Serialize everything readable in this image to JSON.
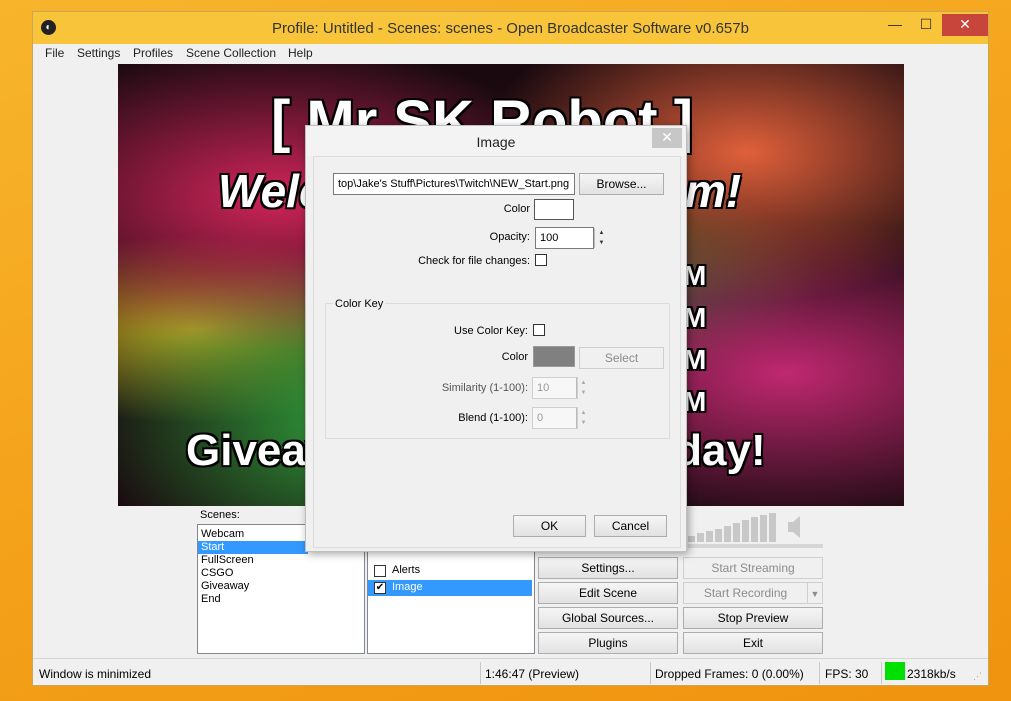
{
  "window": {
    "title": "Profile: Untitled - Scenes: scenes - Open Broadcaster Software v0.657b",
    "minimize": "—",
    "maximize": "☐",
    "close": "✕"
  },
  "menu": [
    "File",
    "Settings",
    "Profiles",
    "Scene Collection",
    "Help"
  ],
  "preview": {
    "line1": "[ Mr SK Robot ]",
    "line2": "Welcome to the Stream!",
    "line3": "Giveaways every Thursday!",
    "m_letters": [
      "M",
      "M",
      "M",
      "M"
    ]
  },
  "scenes": {
    "label": "Scenes:",
    "items": [
      "Webcam",
      "Start",
      "FullScreen",
      "CSGO",
      "Giveaway",
      "End"
    ],
    "selected": "Start"
  },
  "sources": {
    "items": [
      {
        "label": "Alerts",
        "checked": false
      },
      {
        "label": "Image",
        "checked": true
      }
    ],
    "selected": "Image"
  },
  "buttons": {
    "settings": "Settings...",
    "start_streaming": "Start Streaming",
    "edit_scene": "Edit Scene",
    "start_recording": "Start Recording",
    "global_sources": "Global Sources...",
    "stop_preview": "Stop Preview",
    "plugins": "Plugins",
    "exit": "Exit"
  },
  "status": {
    "left": "Window is minimized",
    "time": "1:46:47 (Preview)",
    "dropped": "Dropped Frames: 0 (0.00%)",
    "fps": "FPS: 30",
    "bitrate": "2318kb/s",
    "indicator_color": "#00e000"
  },
  "dialog": {
    "title": "Image",
    "close": "✕",
    "file_path": "top\\Jake's Stuff\\Pictures\\Twitch\\NEW_Start.png",
    "browse": "Browse...",
    "color_label": "Color",
    "color_value": "#ffffff",
    "opacity_label": "Opacity:",
    "opacity_value": "100",
    "check_changes_label": "Check for file changes:",
    "colorkey_group": "Color Key",
    "use_colorkey_label": "Use Color Key:",
    "ck_color_label": "Color",
    "ck_color_value": "#808080",
    "select": "Select",
    "similarity_label": "Similarity (1-100):",
    "similarity_value": "10",
    "blend_label": "Blend (1-100):",
    "blend_value": "0",
    "ok": "OK",
    "cancel": "Cancel"
  }
}
